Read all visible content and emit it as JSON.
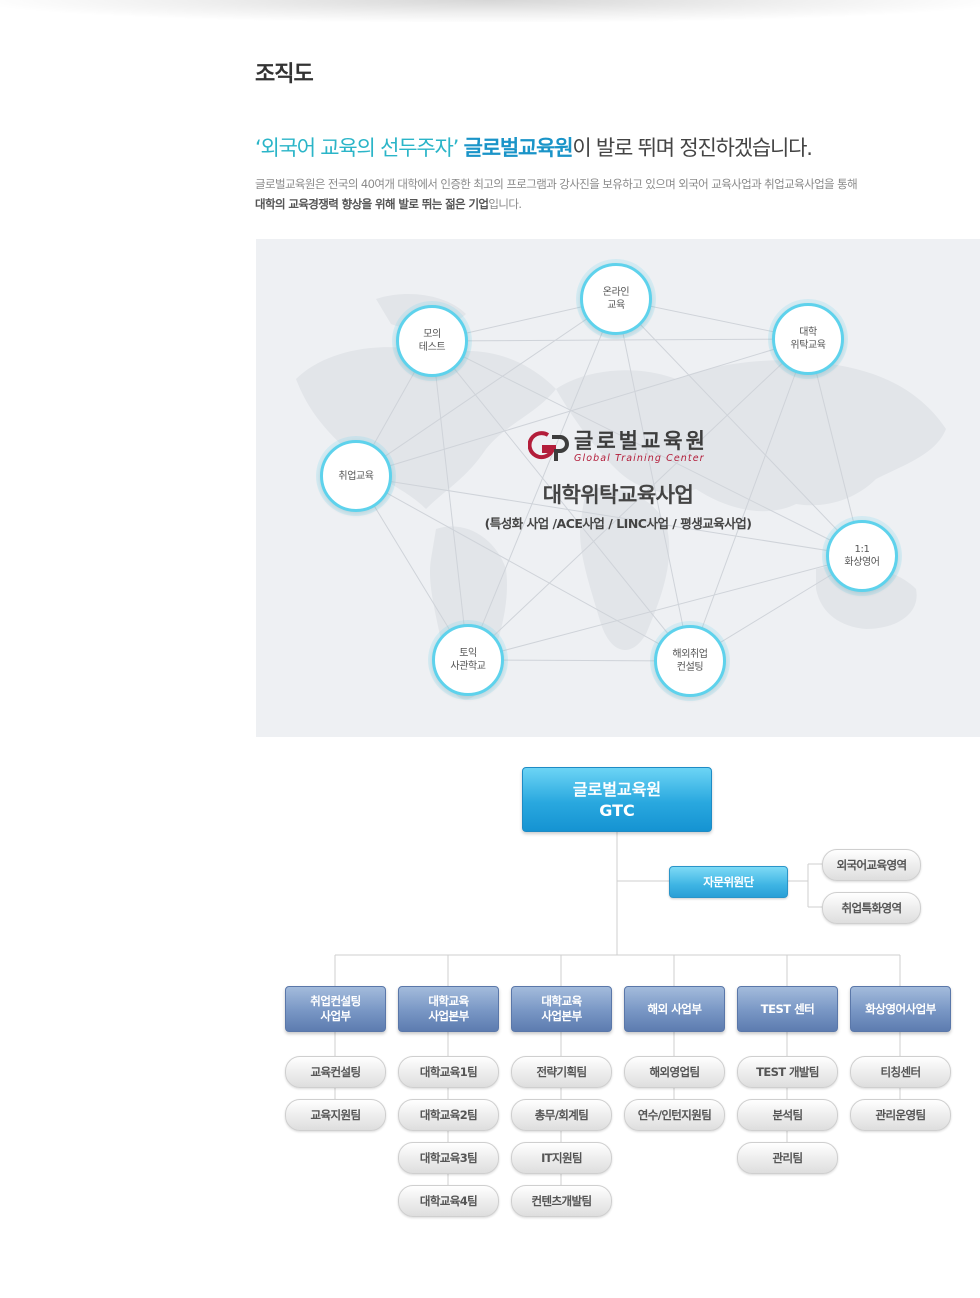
{
  "page": {
    "title": "조직도"
  },
  "headline": {
    "slogan": "‘외국어 교육의 선두주자’",
    "brand": "글로벌교육원",
    "rest": "이 발로 뛰며 정진하겠습니다."
  },
  "intro": {
    "line1": "글로벌교육원은 전국의 40여개 대학에서 인증한 최고의 프로그램과 강사진을 보유하고 있으며 외국어 교육사업과 취업교육사업을 통해",
    "line2_strong": "대학의 교육경쟁력 향상을 위해 발로 뛰는 젊은 기업",
    "line2_rest": "입니다."
  },
  "business_map": {
    "logo_ko": "글로벌교육원",
    "logo_en": "Global Training Center",
    "center_title": "대학위탁교육사업",
    "center_sub": "(특성화 사업 /ACE사업 / LINC사업 / 평생교육사업)",
    "nodes": [
      "온라인\n교육",
      "모의\n테스트",
      "대학\n위탁교육",
      "취업교육",
      "1:1\n화상영어",
      "토익\n사관학교",
      "해외취업\n컨설팅"
    ]
  },
  "org_chart": {
    "root": {
      "line1": "글로벌교육원",
      "line2": "GTC"
    },
    "advisory": {
      "label": "자문위원단",
      "areas": [
        "외국어교육영역",
        "취업특화영역"
      ]
    },
    "departments": [
      {
        "name": "취업컨설팅\n사업부",
        "teams": [
          "교육컨설팅",
          "교육지원팀"
        ]
      },
      {
        "name": "대학교육\n사업본부",
        "teams": [
          "대학교육1팀",
          "대학교육2팀",
          "대학교육3팀",
          "대학교육4팀"
        ]
      },
      {
        "name": "대학교육\n사업본부",
        "teams": [
          "전략기획팀",
          "총무/회계팀",
          "IT지원팀",
          "컨텐츠개발팀"
        ]
      },
      {
        "name": "해외 사업부",
        "teams": [
          "해외영업팀",
          "연수/인턴지원팀"
        ]
      },
      {
        "name": "TEST 센터",
        "teams": [
          "TEST 개발팀",
          "분석팀",
          "관리팀"
        ]
      },
      {
        "name": "화상영어사업부",
        "teams": [
          "티칭센터",
          "관리운영팀"
        ]
      }
    ]
  },
  "colors": {
    "accent_cyan": "#2bb5c8",
    "brand_blue": "#1a94c8",
    "node_border": "#5ed2ec",
    "dept_blue": "#7896c4",
    "logo_red": "#b31d3a"
  }
}
